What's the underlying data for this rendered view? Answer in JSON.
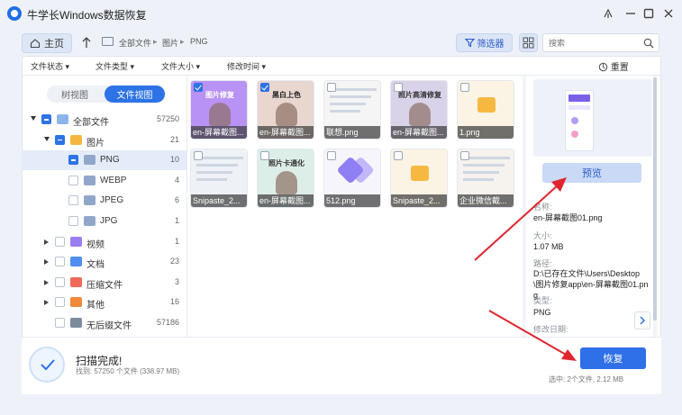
{
  "window": {
    "title": "牛学长Windows数据恢复",
    "accent": "#2d73e6"
  },
  "nav": {
    "home_label": "主页",
    "breadcrumb": [
      "全部文件",
      "图片",
      "PNG"
    ],
    "filter_label": "筛选器",
    "search_placeholder": "搜索"
  },
  "filters": {
    "items": [
      "文件状态",
      "文件类型",
      "文件大小",
      "修改时间"
    ],
    "reset_label": "重置"
  },
  "view_toggle": {
    "tree_label": "树视图",
    "file_label": "文件视图",
    "active": "文件视图"
  },
  "tree": {
    "rows": [
      {
        "label": "全部文件",
        "count": "57250",
        "icon": "monitor-icon",
        "expand": "down",
        "check": "partial"
      },
      {
        "label": "图片",
        "count": "21",
        "icon": "image-folder-icon",
        "expand": "down",
        "check": "partial"
      },
      {
        "label": "PNG",
        "count": "10",
        "icon": "folder-icon",
        "expand": "none",
        "check": "partial",
        "selected": true
      },
      {
        "label": "WEBP",
        "count": "4",
        "icon": "folder-icon",
        "expand": "none",
        "check": "none"
      },
      {
        "label": "JPEG",
        "count": "6",
        "icon": "folder-icon",
        "expand": "none",
        "check": "none"
      },
      {
        "label": "JPG",
        "count": "1",
        "icon": "folder-icon",
        "expand": "none",
        "check": "none"
      },
      {
        "label": "视频",
        "count": "1",
        "icon": "video-icon",
        "expand": "right",
        "check": "none"
      },
      {
        "label": "文档",
        "count": "23",
        "icon": "document-icon",
        "expand": "right",
        "check": "none"
      },
      {
        "label": "压缩文件",
        "count": "3",
        "icon": "archive-icon",
        "expand": "right",
        "check": "none"
      },
      {
        "label": "其他",
        "count": "16",
        "icon": "other-icon",
        "expand": "right",
        "check": "none"
      },
      {
        "label": "无后缀文件",
        "count": "57186",
        "icon": "unknown-file-icon",
        "expand": "none",
        "check": "none"
      }
    ]
  },
  "files": [
    {
      "name": "en-屏幕截图...",
      "checked": true,
      "thumb_text": "图片修复"
    },
    {
      "name": "en-屏幕截图...",
      "checked": true,
      "thumb_text": "黑白上色"
    },
    {
      "name": "联想.png",
      "checked": false,
      "thumb_text": ""
    },
    {
      "name": "en-屏幕截图...",
      "checked": false,
      "thumb_text": "照片高清修复"
    },
    {
      "name": "1.png",
      "checked": false,
      "thumb_text": ""
    },
    {
      "name": "Snipaste_2...",
      "checked": false,
      "thumb_text": ""
    },
    {
      "name": "en-屏幕截图...",
      "checked": false,
      "thumb_text": "照片卡通化"
    },
    {
      "name": "512.png",
      "checked": false,
      "thumb_text": ""
    },
    {
      "name": "Snipaste_2...",
      "checked": false,
      "thumb_text": ""
    },
    {
      "name": "企业微信截...",
      "checked": false,
      "thumb_text": ""
    }
  ],
  "details": {
    "preview_label": "预览",
    "name_key": "名称:",
    "name_value": "en-屏幕截图01.png",
    "size_key": "大小:",
    "size_value": "1.07 MB",
    "path_key": "路径:",
    "path_value": "D:\\已存在文件\\Users\\Desktop\\图片修复app\\en-屏幕截图01.png",
    "type_key": "类型:",
    "type_value": "PNG",
    "modified_key": "修改日期:"
  },
  "status": {
    "title": "扫描完成!",
    "subtitle": "找到: 57250 个文件 (338.97 MB)",
    "recover_label": "恢复",
    "selection": "选中: 2个文件, 2.12 MB"
  }
}
